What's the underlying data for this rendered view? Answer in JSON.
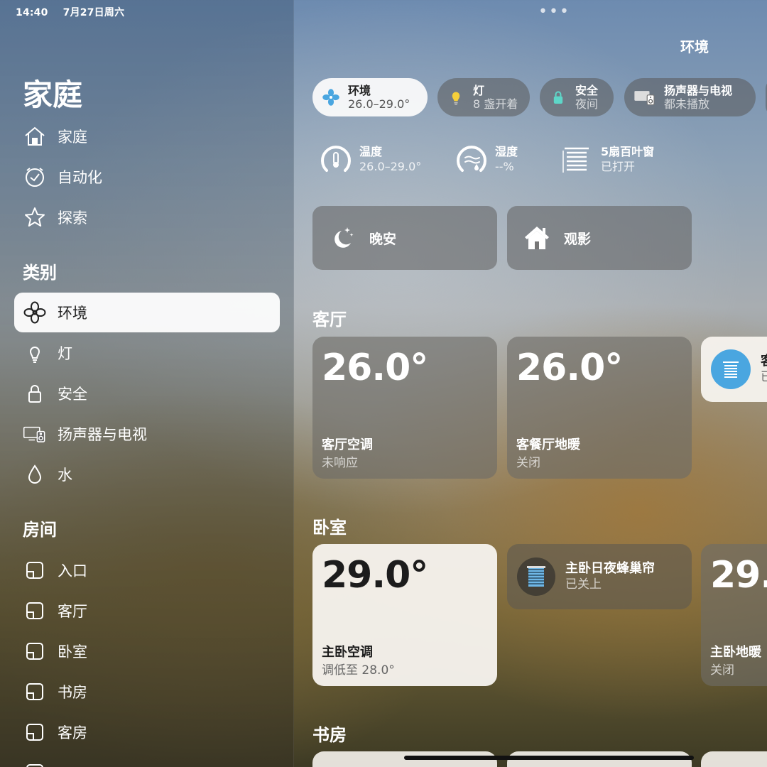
{
  "status": {
    "time": "14:40",
    "date": "7月27日周六"
  },
  "sidebar": {
    "title": "家庭",
    "top_items": [
      {
        "label": "家庭",
        "icon": "house-icon"
      },
      {
        "label": "自动化",
        "icon": "clock-icon"
      },
      {
        "label": "探索",
        "icon": "star-icon"
      }
    ],
    "categories_heading": "类别",
    "categories": [
      {
        "label": "环境",
        "icon": "fan-icon",
        "selected": true
      },
      {
        "label": "灯",
        "icon": "lightbulb-icon"
      },
      {
        "label": "安全",
        "icon": "lock-icon"
      },
      {
        "label": "扬声器与电视",
        "icon": "speaker-tv-icon"
      },
      {
        "label": "水",
        "icon": "water-drop-icon"
      }
    ],
    "rooms_heading": "房间",
    "rooms": [
      {
        "label": "入口"
      },
      {
        "label": "客厅"
      },
      {
        "label": "卧室"
      },
      {
        "label": "书房"
      },
      {
        "label": "客房"
      }
    ]
  },
  "main": {
    "title": "环境",
    "chips": [
      {
        "label": "环境",
        "sub": "26.0–29.0°",
        "icon": "fan-icon"
      },
      {
        "label": "灯",
        "sub": "8 盏开着",
        "icon": "lightbulb-icon"
      },
      {
        "label": "安全",
        "sub": "夜间",
        "icon": "lock-icon"
      },
      {
        "label": "扬声器与电视",
        "sub": "都未播放",
        "icon": "speaker-tv-icon"
      }
    ],
    "stats": [
      {
        "label": "温度",
        "value": "26.0–29.0°",
        "icon": "thermometer-gauge-icon"
      },
      {
        "label": "湿度",
        "value": "--%",
        "icon": "humidity-gauge-icon"
      },
      {
        "label": "5扇百叶窗",
        "value": "已打开",
        "icon": "blinds-icon"
      }
    ],
    "scenes": [
      {
        "label": "晚安",
        "icon": "moon-stars-icon"
      },
      {
        "label": "观影",
        "icon": "house-scene-icon"
      }
    ],
    "living_room": {
      "heading": "客厅",
      "tiles": [
        {
          "temp": "26.0°",
          "name": "客厅空调",
          "status": "未响应"
        },
        {
          "temp": "26.0°",
          "name": "客餐厅地暖",
          "status": "关闭"
        }
      ],
      "partial_label": "客",
      "partial_sub": "已"
    },
    "bedroom": {
      "heading": "卧室",
      "ac": {
        "temp": "29.0°",
        "name": "主卧空调",
        "status": "调低至 28.0°"
      },
      "blinds": {
        "name": "主卧日夜蜂巢帘",
        "status": "已关上"
      },
      "floor": {
        "temp": "29.",
        "name": "主卧地暖",
        "status": "关闭"
      }
    },
    "study_heading": "书房"
  },
  "colors": {
    "accent_blue": "#4aa6e0",
    "lock_teal": "#5ed6c8",
    "bulb_yellow": "#f5cf3a"
  }
}
